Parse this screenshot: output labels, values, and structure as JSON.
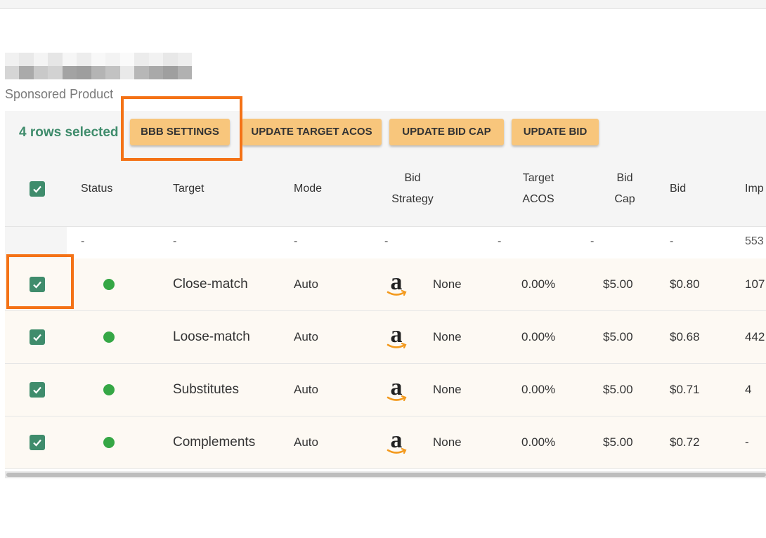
{
  "page": {
    "subtitle": "Sponsored Product"
  },
  "colors": {
    "accent_green": "#3f8c6c",
    "button_orange": "#f8c67c",
    "highlight_orange": "#f47216",
    "status_active": "#35a745"
  },
  "toolbar": {
    "selected_count": "4 rows selected",
    "buttons": [
      {
        "label": "BBB SETTINGS"
      },
      {
        "label": "UPDATE TARGET ACOS"
      },
      {
        "label": "UPDATE BID CAP"
      },
      {
        "label": "UPDATE BID"
      }
    ]
  },
  "table": {
    "headers": {
      "status": "Status",
      "target": "Target",
      "mode": "Mode",
      "bid_strategy_1": "Bid",
      "bid_strategy_2": "Strategy",
      "target_acos_1": "Target",
      "target_acos_2": "ACOS",
      "bid_cap_1": "Bid",
      "bid_cap_2": "Cap",
      "bid": "Bid",
      "impressions": "Imp"
    },
    "summary": {
      "status": "-",
      "target": "-",
      "mode": "-",
      "bid_strategy": "-",
      "strategy_value": "-",
      "target_acos": "-",
      "bid_cap": "-",
      "bid": "-",
      "impressions": "553"
    },
    "rows": [
      {
        "checked": true,
        "status": "active",
        "target": "Close-match",
        "mode": "Auto",
        "platform_icon": "amazon-icon",
        "bid_strategy": "None",
        "target_acos": "0.00%",
        "bid_cap": "$5.00",
        "bid": "$0.80",
        "impressions": "107"
      },
      {
        "checked": true,
        "status": "active",
        "target": "Loose-match",
        "mode": "Auto",
        "platform_icon": "amazon-icon",
        "bid_strategy": "None",
        "target_acos": "0.00%",
        "bid_cap": "$5.00",
        "bid": "$0.68",
        "impressions": "442"
      },
      {
        "checked": true,
        "status": "active",
        "target": "Substitutes",
        "mode": "Auto",
        "platform_icon": "amazon-icon",
        "bid_strategy": "None",
        "target_acos": "0.00%",
        "bid_cap": "$5.00",
        "bid": "$0.71",
        "impressions": "4"
      },
      {
        "checked": true,
        "status": "active",
        "target": "Complements",
        "mode": "Auto",
        "platform_icon": "amazon-icon",
        "bid_strategy": "None",
        "target_acos": "0.00%",
        "bid_cap": "$5.00",
        "bid": "$0.72",
        "impressions": "-"
      }
    ]
  }
}
